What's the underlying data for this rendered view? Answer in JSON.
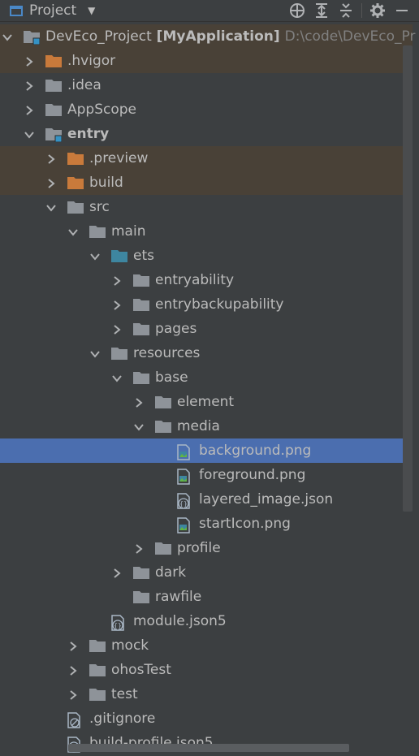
{
  "toolbar": {
    "title": "Project",
    "actions": [
      "locate-icon",
      "expand-all-icon",
      "collapse-all-icon",
      "gear-icon",
      "minimize-icon"
    ]
  },
  "colors": {
    "background": "#3c3f41",
    "selection": "#4b6eaf",
    "excluded_highlight": "#494137",
    "folder": "#8e9399",
    "excluded_folder": "#c97a3b",
    "source_folder": "#3e86a0",
    "module_badge": "#3592c4"
  },
  "tree": [
    {
      "label": "DevEco_Project",
      "extra": "[MyApplication]",
      "path": "D:\\code\\DevEco_Pr",
      "depth": 0,
      "arrow": "down",
      "icon": "module-folder-icon",
      "highlight": "root"
    },
    {
      "label": ".hvigor",
      "depth": 1,
      "arrow": "right",
      "icon": "excluded-folder-icon",
      "highlight": "excluded"
    },
    {
      "label": ".idea",
      "depth": 1,
      "arrow": "right",
      "icon": "folder-icon"
    },
    {
      "label": "AppScope",
      "depth": 1,
      "arrow": "right",
      "icon": "folder-icon"
    },
    {
      "label": "entry",
      "depth": 1,
      "arrow": "down",
      "icon": "module-folder-icon",
      "bold": true
    },
    {
      "label": ".preview",
      "depth": 2,
      "arrow": "right",
      "icon": "excluded-folder-icon",
      "highlight": "excluded"
    },
    {
      "label": "build",
      "depth": 2,
      "arrow": "right",
      "icon": "excluded-folder-icon",
      "highlight": "excluded"
    },
    {
      "label": "src",
      "depth": 2,
      "arrow": "down",
      "icon": "folder-icon"
    },
    {
      "label": "main",
      "depth": 3,
      "arrow": "down",
      "icon": "folder-icon"
    },
    {
      "label": "ets",
      "depth": 4,
      "arrow": "down",
      "icon": "source-folder-icon"
    },
    {
      "label": "entryability",
      "depth": 5,
      "arrow": "right",
      "icon": "folder-icon"
    },
    {
      "label": "entrybackupability",
      "depth": 5,
      "arrow": "right",
      "icon": "folder-icon"
    },
    {
      "label": "pages",
      "depth": 5,
      "arrow": "right",
      "icon": "folder-icon"
    },
    {
      "label": "resources",
      "depth": 4,
      "arrow": "down",
      "icon": "folder-icon"
    },
    {
      "label": "base",
      "depth": 5,
      "arrow": "down",
      "icon": "folder-icon"
    },
    {
      "label": "element",
      "depth": 6,
      "arrow": "right",
      "icon": "folder-icon"
    },
    {
      "label": "media",
      "depth": 6,
      "arrow": "down",
      "icon": "folder-icon"
    },
    {
      "label": "background.png",
      "depth": 7,
      "arrow": "none",
      "icon": "image-file-icon",
      "selected": true
    },
    {
      "label": "foreground.png",
      "depth": 7,
      "arrow": "none",
      "icon": "image-file-icon"
    },
    {
      "label": "layered_image.json",
      "depth": 7,
      "arrow": "none",
      "icon": "json-file-icon"
    },
    {
      "label": "startIcon.png",
      "depth": 7,
      "arrow": "none",
      "icon": "image-file-icon"
    },
    {
      "label": "profile",
      "depth": 6,
      "arrow": "right",
      "icon": "folder-icon"
    },
    {
      "label": "dark",
      "depth": 5,
      "arrow": "right",
      "icon": "folder-icon"
    },
    {
      "label": "rawfile",
      "depth": 5,
      "arrow": "none",
      "icon": "folder-icon"
    },
    {
      "label": "module.json5",
      "depth": 4,
      "arrow": "none",
      "icon": "json-file-icon"
    },
    {
      "label": "mock",
      "depth": 3,
      "arrow": "right",
      "icon": "folder-icon"
    },
    {
      "label": "ohosTest",
      "depth": 3,
      "arrow": "right",
      "icon": "folder-icon"
    },
    {
      "label": "test",
      "depth": 3,
      "arrow": "right",
      "icon": "folder-icon"
    },
    {
      "label": ".gitignore",
      "depth": 2,
      "arrow": "none",
      "icon": "ignore-file-icon"
    },
    {
      "label": "build-profile.json5",
      "depth": 2,
      "arrow": "none",
      "icon": "json-file-icon"
    }
  ]
}
